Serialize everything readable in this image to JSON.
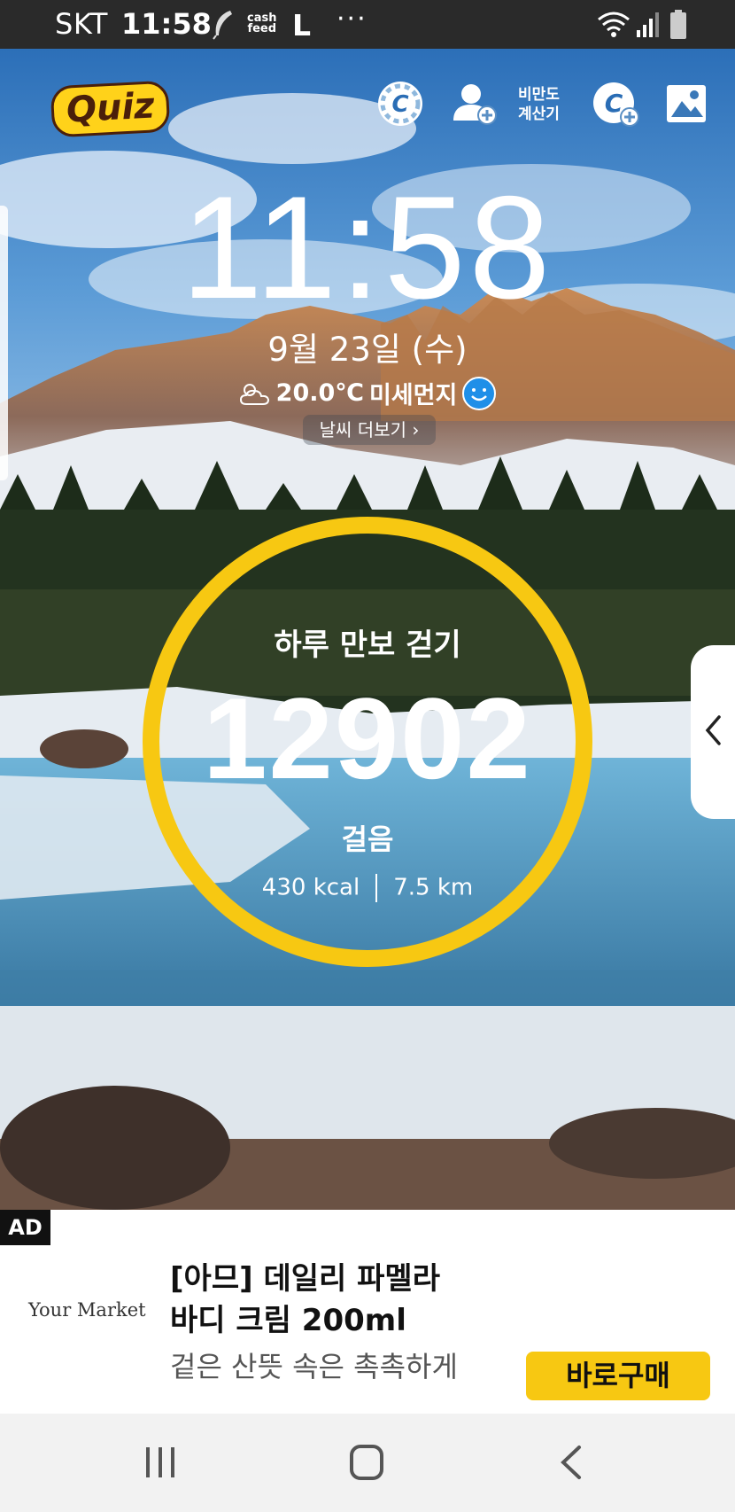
{
  "status_bar": {
    "carrier": "SKT",
    "time": "11:58",
    "notification_icons": [
      "feather-icon",
      "cashfeed-icon",
      "l-app-icon",
      "more-notifications-icon"
    ],
    "cashfeed_text": "cash feed",
    "more": "···",
    "system_icons": [
      "wifi-icon",
      "signal-icon",
      "battery-icon"
    ]
  },
  "top_bar": {
    "quiz_label": "Quiz",
    "icons": [
      "cashslide-coin-icon",
      "add-friend-icon",
      "coin-plus-icon",
      "wallpaper-image-icon"
    ],
    "obesity_calc_line1": "비만도",
    "obesity_calc_line2": "계산기"
  },
  "lock": {
    "time": "11:58",
    "date": "9월 23일 (수)",
    "temperature": "20.0℃",
    "dust_label": "미세먼지",
    "dust_status_icon": "smile-good-icon",
    "weather_icon": "partly-cloudy-icon",
    "weather_more": "날씨 더보기 ›"
  },
  "pedometer": {
    "title": "하루 만보 걷기",
    "steps": "12902",
    "unit": "걸음",
    "kcal": "430 kcal",
    "distance": "7.5 km",
    "ring_color": "#f7c812"
  },
  "ad": {
    "badge": "AD",
    "brand": "Your Market",
    "title_line1": "[아므]  데일리 파멜라",
    "title_line2": "바디 크림 200ml",
    "subtitle": "겉은 산뜻 속은 촉촉하게",
    "cta": "바로구매",
    "cta_color": "#f7c812"
  },
  "nav_bar": {
    "buttons": [
      "recent-apps-icon",
      "home-icon",
      "back-icon"
    ]
  }
}
